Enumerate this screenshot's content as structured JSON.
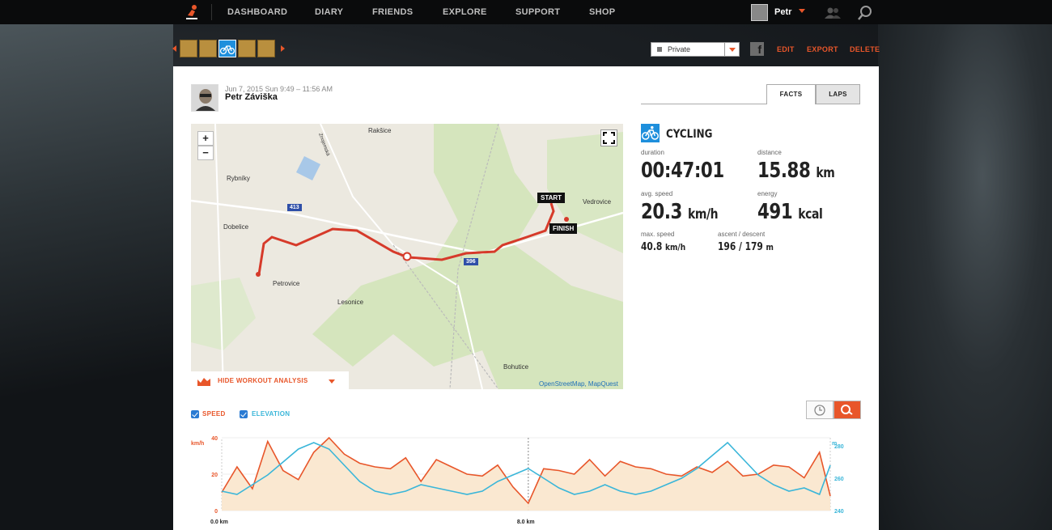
{
  "nav": {
    "items": [
      "DASHBOARD",
      "DIARY",
      "FRIENDS",
      "EXPLORE",
      "SUPPORT",
      "SHOP"
    ],
    "user": "Petr"
  },
  "toolbar": {
    "privacy": "Private",
    "edit": "EDIT",
    "export": "EXPORT",
    "delete": "DELETE"
  },
  "workout": {
    "date": "Jun 7, 2015 Sun 9:49 – 11:56 AM",
    "person": "Petr Záviška"
  },
  "map": {
    "zoom_in": "+",
    "zoom_out": "−",
    "start": "START",
    "finish": "FINISH",
    "attribution": "OpenStreetMap, MapQuest",
    "places": [
      "Rakšice",
      "Rybníky",
      "Dobelice",
      "Petrovice",
      "Lesonice",
      "Vedrovice",
      "Bohutice",
      "Znojemská"
    ],
    "roads": [
      "413",
      "396"
    ],
    "hide_analysis": "HIDE WORKOUT ANALYSIS"
  },
  "tabs": {
    "facts": "FACTS",
    "laps": "LAPS"
  },
  "facts": {
    "sport": "CYCLING",
    "duration_label": "duration",
    "duration": "00:47:01",
    "distance_label": "distance",
    "distance": "15.88",
    "distance_unit": "km",
    "avg_speed_label": "avg. speed",
    "avg_speed": "20.3",
    "avg_speed_unit": "km/h",
    "energy_label": "energy",
    "energy": "491",
    "energy_unit": "kcal",
    "max_speed_label": "max. speed",
    "max_speed": "40.8",
    "max_speed_unit": "km/h",
    "ascent_label": "ascent / descent",
    "ascent": "196 / 179",
    "ascent_unit": "m"
  },
  "chart_controls": {
    "speed": "SPEED",
    "elevation": "ELEVATION"
  },
  "colors": {
    "accent": "#e8562a",
    "speed": "#e8562a",
    "elevation": "#3ab6d9",
    "sport": "#1e8fdc"
  },
  "chart_data": {
    "type": "line",
    "y_left_unit": "km/h",
    "y_right_unit": "m",
    "y_left_ticks": [
      "40",
      "20",
      "0"
    ],
    "y_right_ticks": [
      "280",
      "260",
      "240"
    ],
    "x_ticks": [
      "0.0 km",
      "8.0 km"
    ],
    "ylim_left": [
      0,
      40
    ],
    "ylim_right": [
      240,
      285
    ],
    "xlim": [
      0,
      15.88
    ],
    "series": [
      {
        "name": "SPEED",
        "x": [
          0,
          0.4,
          0.8,
          1.2,
          1.6,
          2.0,
          2.4,
          2.8,
          3.2,
          3.6,
          4.0,
          4.4,
          4.8,
          5.2,
          5.6,
          6.0,
          6.4,
          6.8,
          7.2,
          7.6,
          8.0,
          8.4,
          8.8,
          9.2,
          9.6,
          10.0,
          10.4,
          10.8,
          11.2,
          11.6,
          12.0,
          12.4,
          12.8,
          13.2,
          13.6,
          14.0,
          14.4,
          14.8,
          15.2,
          15.6,
          15.88
        ],
        "values": [
          10,
          24,
          12,
          38,
          22,
          17,
          32,
          40,
          31,
          26,
          24,
          23,
          29,
          16,
          28,
          24,
          20,
          19,
          25,
          13,
          4,
          23,
          22,
          20,
          28,
          19,
          27,
          24,
          23,
          20,
          19,
          24,
          21,
          27,
          19,
          20,
          25,
          24,
          18,
          32,
          8
        ]
      },
      {
        "name": "ELEVATION",
        "x": [
          0,
          0.4,
          0.8,
          1.2,
          1.6,
          2.0,
          2.4,
          2.8,
          3.2,
          3.6,
          4.0,
          4.4,
          4.8,
          5.2,
          5.6,
          6.0,
          6.4,
          6.8,
          7.2,
          7.6,
          8.0,
          8.4,
          8.8,
          9.2,
          9.6,
          10.0,
          10.4,
          10.8,
          11.2,
          11.6,
          12.0,
          12.4,
          12.8,
          13.2,
          13.6,
          14.0,
          14.4,
          14.8,
          15.2,
          15.6,
          15.88
        ],
        "values": [
          252,
          250,
          256,
          262,
          270,
          278,
          282,
          278,
          268,
          258,
          252,
          250,
          252,
          256,
          254,
          252,
          250,
          252,
          258,
          262,
          266,
          260,
          254,
          250,
          252,
          256,
          252,
          250,
          252,
          256,
          260,
          266,
          274,
          282,
          272,
          262,
          256,
          252,
          254,
          250,
          268
        ]
      }
    ]
  }
}
